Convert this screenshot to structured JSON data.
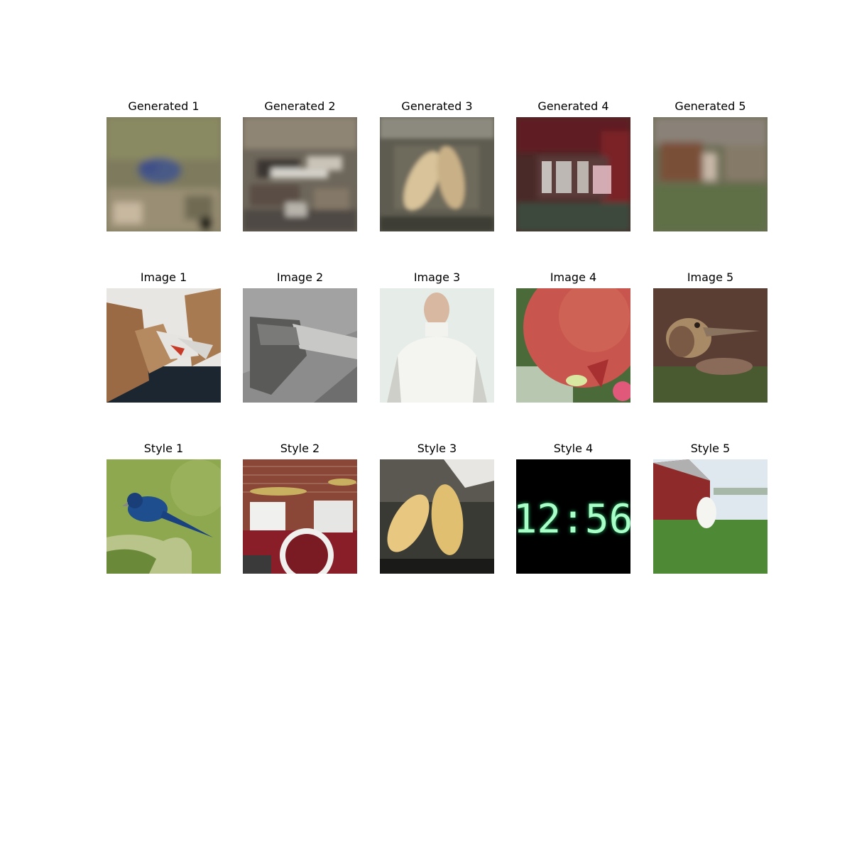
{
  "figure": {
    "rows": [
      {
        "name": "generated",
        "titles": [
          "Generated 1",
          "Generated 2",
          "Generated 3",
          "Generated 4",
          "Generated 5"
        ]
      },
      {
        "name": "image",
        "titles": [
          "Image 1",
          "Image 2",
          "Image 3",
          "Image 4",
          "Image 5"
        ]
      },
      {
        "name": "style",
        "titles": [
          "Style 1",
          "Style 2",
          "Style 3",
          "Style 4",
          "Style 5"
        ]
      }
    ],
    "clock_display": "12:56"
  }
}
